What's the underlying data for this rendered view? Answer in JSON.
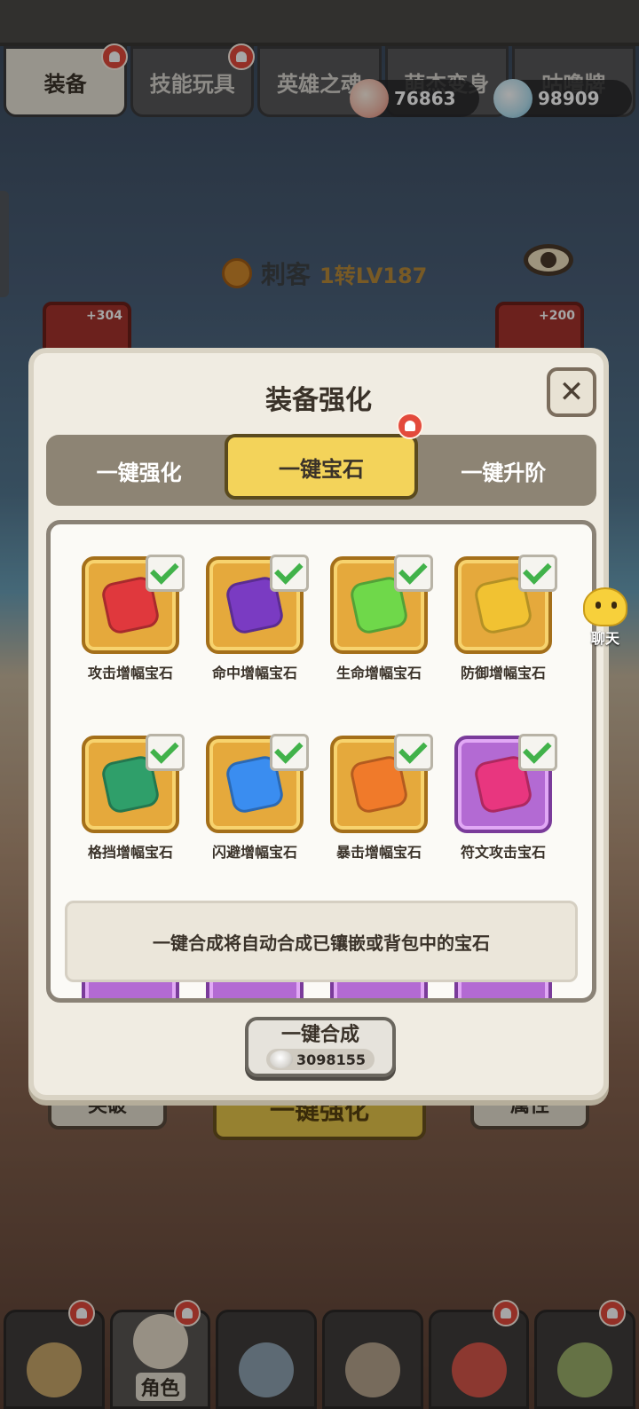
{
  "top_tabs": [
    {
      "label": "装备",
      "active": true
    },
    {
      "label": "技能玩具"
    },
    {
      "label": "英雄之魂"
    },
    {
      "label": "萌杰变身"
    },
    {
      "label": "咕噜牌"
    }
  ],
  "currency": [
    {
      "icon": "shell-coin-icon",
      "value": "76863"
    },
    {
      "icon": "pearl-shell-icon",
      "value": "98909"
    }
  ],
  "hero": {
    "job": "刺客",
    "level": "1转LV187"
  },
  "equip_slots": [
    {
      "bonus": "+304"
    },
    {
      "bonus": "+200"
    }
  ],
  "bottom_buttons": {
    "left": "突破",
    "center": "一键强化",
    "right": "属性"
  },
  "dock": [
    {
      "label": ""
    },
    {
      "label": "角色",
      "active": true
    },
    {
      "label": ""
    },
    {
      "label": ""
    },
    {
      "label": ""
    },
    {
      "label": ""
    }
  ],
  "modal": {
    "title": "装备强化",
    "tabs": [
      "一键强化",
      "一键宝石",
      "一键升阶"
    ],
    "active_tab": 1,
    "gems": [
      {
        "name": "攻击增幅宝石",
        "color": "#e0383d",
        "frame": "gold",
        "checked": true
      },
      {
        "name": "命中增幅宝石",
        "color": "#7a3bc2",
        "frame": "gold",
        "checked": true
      },
      {
        "name": "生命增幅宝石",
        "color": "#6fd84a",
        "frame": "gold",
        "checked": true
      },
      {
        "name": "防御增幅宝石",
        "color": "#f1c232",
        "frame": "gold",
        "checked": true
      },
      {
        "name": "格挡增幅宝石",
        "color": "#2f9f6a",
        "frame": "gold",
        "checked": true
      },
      {
        "name": "闪避增幅宝石",
        "color": "#3a8df0",
        "frame": "gold",
        "checked": true
      },
      {
        "name": "暴击增幅宝石",
        "color": "#f07a2a",
        "frame": "gold",
        "checked": true
      },
      {
        "name": "符文攻击宝石",
        "color": "#e8367f",
        "frame": "purple",
        "checked": true
      }
    ],
    "info": "一键合成将自动合成已镶嵌或背包中的宝石",
    "combine_label": "一键合成",
    "combine_cost": "3098155"
  },
  "chat": {
    "label": "聊天"
  }
}
